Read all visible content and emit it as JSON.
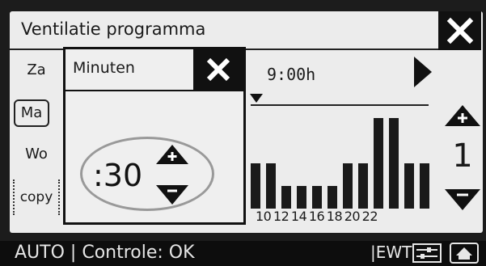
{
  "title": "Ventilatie programma",
  "days": {
    "za": "Za",
    "ma": "Ma",
    "wo": "Wo",
    "copy": "copy"
  },
  "popup": {
    "title": "Minuten",
    "value": ":30"
  },
  "schedule": {
    "time": "9:00h",
    "hour_labels": "10 12 14 16 18 20 22",
    "bar_levels": [
      2,
      2,
      1,
      1,
      1,
      1,
      2,
      2,
      4,
      4,
      2,
      2
    ],
    "current_level": "1"
  },
  "status": {
    "mode": "AUTO",
    "separator": "|",
    "check": "Controle: OK",
    "ewt": "|EWT|"
  },
  "icons": {
    "close": "close-icon",
    "up": "plus-up-icon",
    "down": "minus-down-icon",
    "next": "play-next-icon",
    "settings": "settings-sliders-icon",
    "home": "home-icon"
  }
}
